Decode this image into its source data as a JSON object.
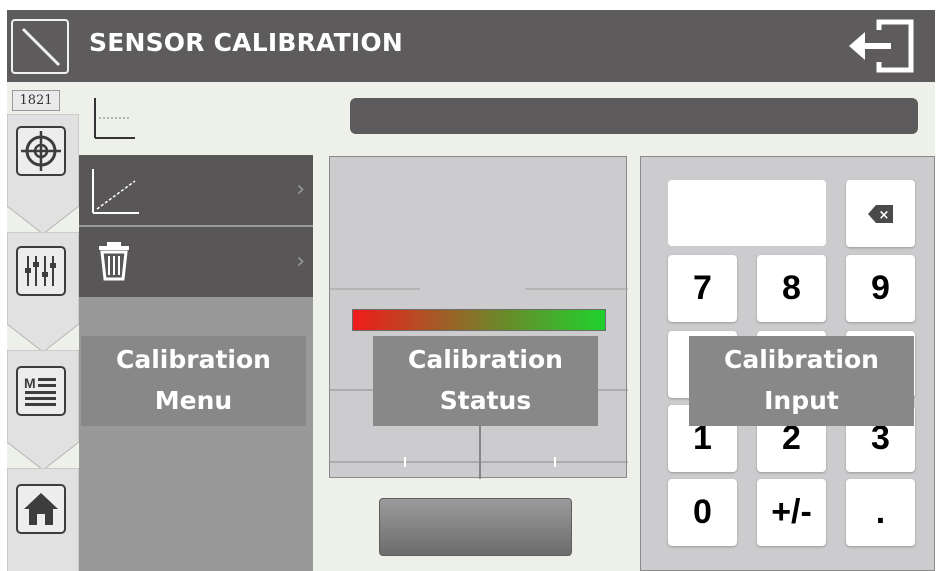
{
  "header": {
    "title": "SENSOR CALIBRATION",
    "app_icon": "calibration-slash-icon",
    "exit_icon": "exit-door-icon"
  },
  "sidebar": {
    "counter": "1821",
    "tabs": [
      {
        "icon": "target-crosshair-icon"
      },
      {
        "icon": "mixer-sliders-icon"
      },
      {
        "icon": "manual-list-icon",
        "icon_text": "M"
      },
      {
        "icon": "home-icon"
      }
    ]
  },
  "menu": {
    "items": [
      {
        "icon": "calibration-curve-icon",
        "chevron": "›"
      },
      {
        "icon": "trash-icon",
        "chevron": "›"
      }
    ]
  },
  "status": {
    "progress": 1.0,
    "gradient_colors": [
      "#ef1c1c",
      "#1fd12e"
    ]
  },
  "keypad": {
    "display_value": "",
    "backspace_icon": "backspace-icon",
    "backspace_glyph": "×",
    "keys": [
      "7",
      "8",
      "9",
      "",
      "",
      "",
      "1",
      "2",
      "3",
      "0",
      "+/-",
      "."
    ]
  },
  "overlays": {
    "menu": [
      "Calibration",
      "Menu"
    ],
    "status": [
      "Calibration",
      "Status"
    ],
    "input": [
      "Calibration",
      "Input"
    ]
  },
  "colors": {
    "header_bg": "#5d5b5c",
    "background": "#eef0ea",
    "menu_bg": "#999999",
    "menu_item_bg": "#585657",
    "panel_bg": "#cccbcd",
    "overlay_bg": "#888888"
  }
}
